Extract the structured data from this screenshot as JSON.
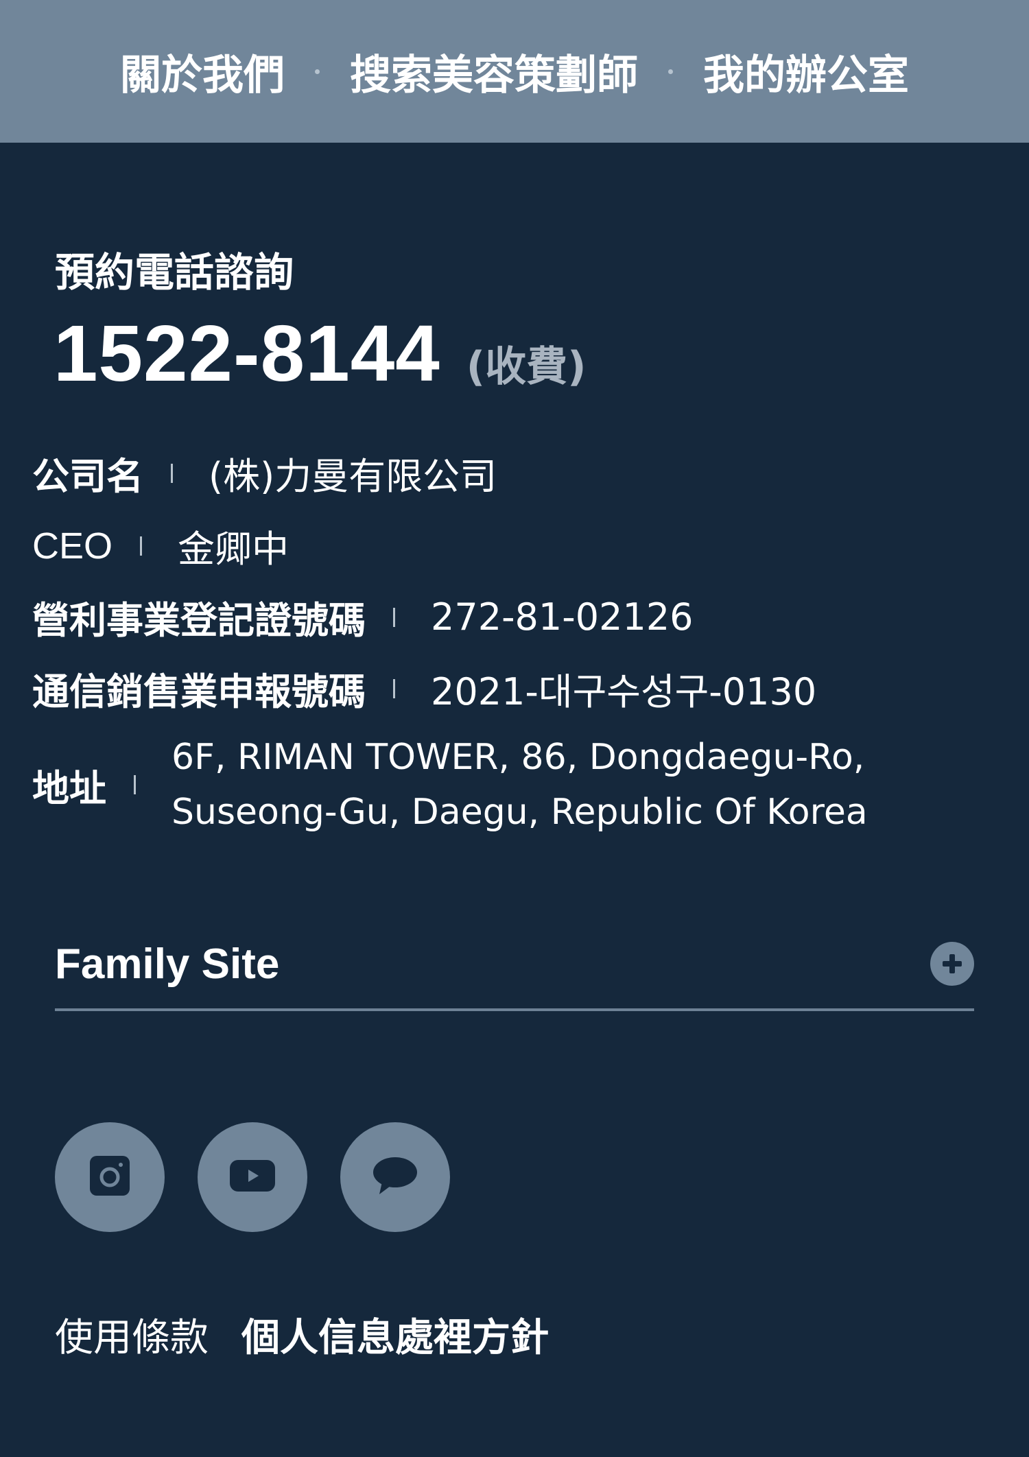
{
  "nav": {
    "items": [
      {
        "label": "關於我們"
      },
      {
        "label": "搜索美容策劃師"
      },
      {
        "label": "我的辦公室"
      }
    ]
  },
  "contact": {
    "label": "預約電話諮詢",
    "phone": "1522-8144",
    "note": "(收費)"
  },
  "company": {
    "name_label": "公司名",
    "name_value": "(株)力曼有限公司",
    "ceo_label": "CEO",
    "ceo_value": "金卿中",
    "biz_label": "營利事業登記證號碼",
    "biz_value": "272-81-02126",
    "telecom_label": "通信銷售業申報號碼",
    "telecom_value": "2021-대구수성구-0130",
    "address_label": "地址",
    "address_line1": "6F, RIMAN TOWER, 86, Dongdaegu-Ro,",
    "address_line2": "Suseong-Gu, Daegu, Republic Of Korea"
  },
  "family_site": {
    "label": "Family Site",
    "icon": "plus-icon"
  },
  "social": [
    {
      "icon": "instagram-icon"
    },
    {
      "icon": "youtube-icon"
    },
    {
      "icon": "chat-icon"
    }
  ],
  "footer": {
    "terms": "使用條款",
    "privacy": "個人信息處裡方針"
  },
  "colors": {
    "background": "#15283c",
    "nav_background": "#71869a",
    "icon_background": "#71869a",
    "text": "#ffffff",
    "muted_text": "#a9b4c0"
  }
}
